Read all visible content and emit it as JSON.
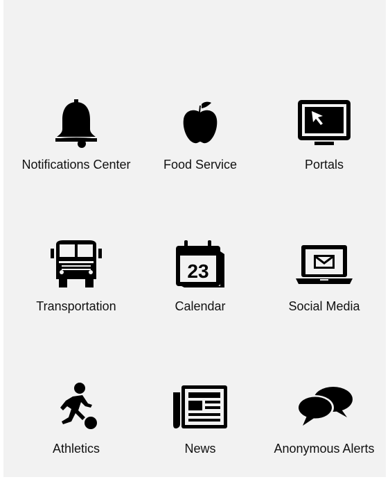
{
  "grid": {
    "tiles": [
      {
        "label": "Notifications Center",
        "icon": "bell-icon"
      },
      {
        "label": "Food Service",
        "icon": "apple-icon"
      },
      {
        "label": "Portals",
        "icon": "monitor-cursor-icon"
      },
      {
        "label": "Transportation",
        "icon": "bus-icon"
      },
      {
        "label": "Calendar",
        "icon": "calendar-icon",
        "date_number": "23"
      },
      {
        "label": "Social Media",
        "icon": "laptop-mail-icon"
      },
      {
        "label": "Athletics",
        "icon": "soccer-player-icon"
      },
      {
        "label": "News",
        "icon": "newspaper-icon"
      },
      {
        "label": "Anonymous Alerts",
        "icon": "speech-bubbles-icon"
      }
    ]
  },
  "colors": {
    "background": "#f2f2f2",
    "icon": "#000000",
    "text": "#111111"
  }
}
